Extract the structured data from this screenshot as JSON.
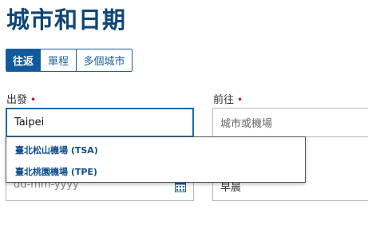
{
  "page_title": "城市和日期",
  "trip_tabs": [
    {
      "label": "往返",
      "active": true
    },
    {
      "label": "單程",
      "active": false
    },
    {
      "label": "多個城市",
      "active": false
    }
  ],
  "from": {
    "label": "出發",
    "required_mark": "•",
    "value": "Taipei"
  },
  "to": {
    "label": "前往",
    "required_mark": "•",
    "placeholder": "城市或機場"
  },
  "suggestions": [
    {
      "label": "臺北松山機場 (TSA)"
    },
    {
      "label": "臺北桃園機場 (TPE)"
    }
  ],
  "date": {
    "placeholder": "dd-mm-yyyy",
    "icon": "calendar-icon"
  },
  "time": {
    "value": "早晨"
  },
  "colors": {
    "brand": "#0f4677",
    "accent": "#0f5a9c",
    "required": "#c8102e"
  }
}
